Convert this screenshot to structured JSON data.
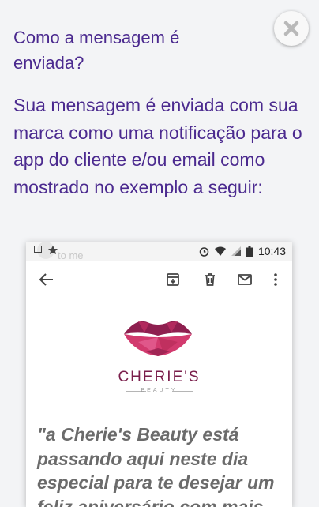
{
  "dialog": {
    "heading": "Como a mensagem é enviada?",
    "body": "Sua mensagem é enviada com sua marca como uma notificação para o app do cliente e/ou email como mostrado no exemplo a seguir:",
    "close_icon": "close-icon"
  },
  "example": {
    "status_bar": {
      "time": "10:43",
      "icons": [
        "gallery-icon",
        "leaf-icon",
        "alarm-icon",
        "wifi-icon",
        "signal-icon",
        "battery-icon"
      ]
    },
    "ghost_text": "to me",
    "toolbar_icons": [
      "back-arrow-icon",
      "archive-icon",
      "delete-icon",
      "mail-icon",
      "more-icon"
    ],
    "brand_name": "CHERIE'S",
    "brand_sub": "BEAUTY",
    "quote": "\"a Cherie's Beauty está passando aqui neste dia especial para te desejar um feliz aniversário com mais",
    "colors": {
      "heading": "#4b2a8f",
      "brand": "#7a1e4b",
      "lips_dark": "#8e1f4f",
      "lips_light": "#d23a6e"
    }
  }
}
